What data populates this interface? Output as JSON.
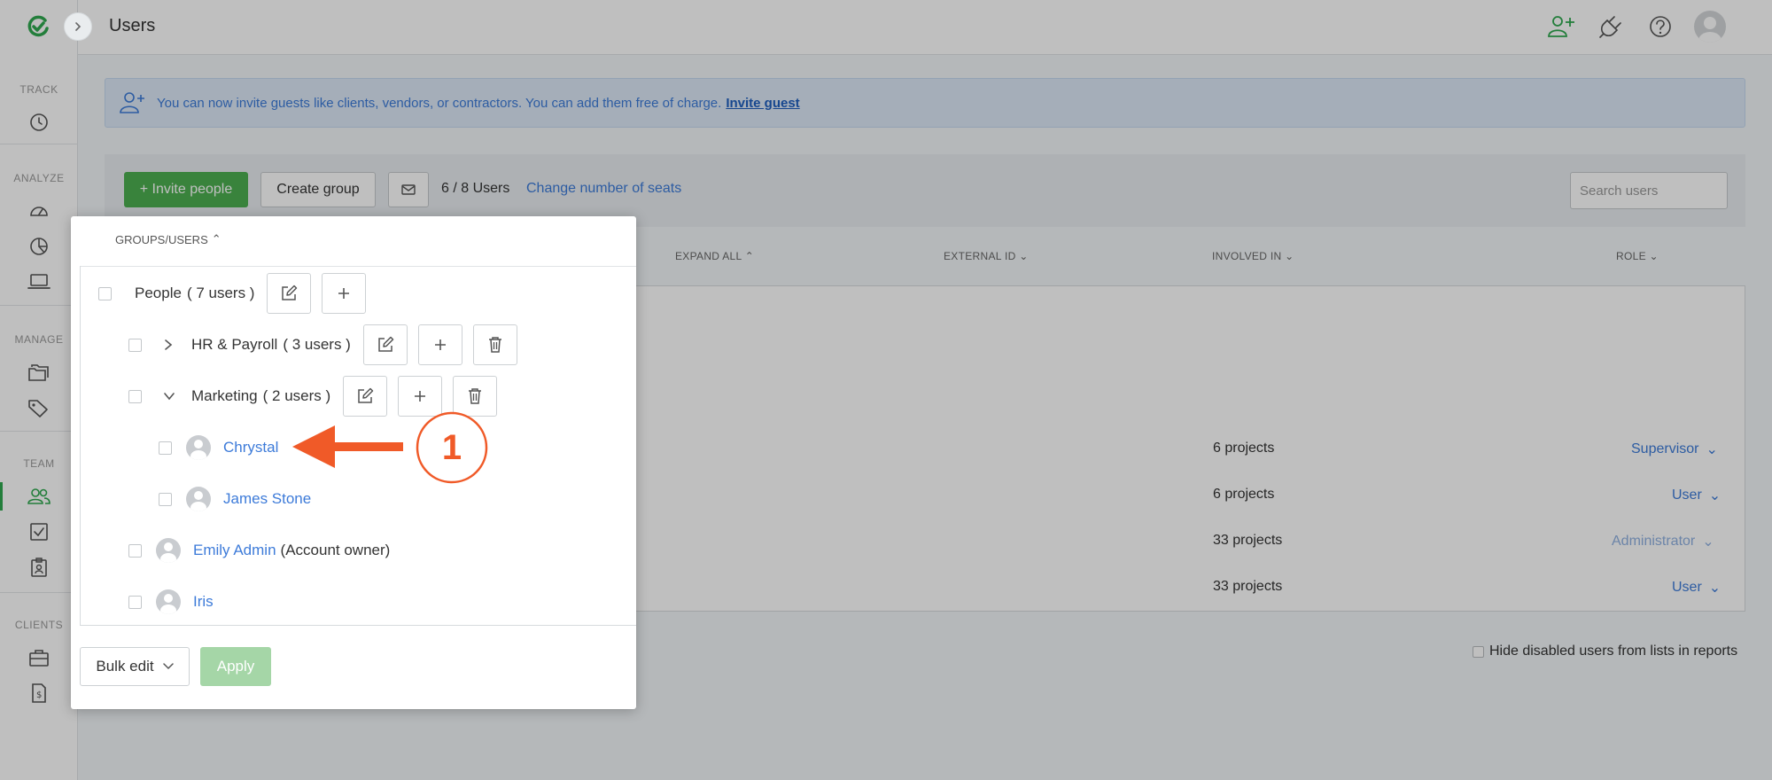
{
  "header": {
    "title": "Users"
  },
  "sidebar": {
    "sections": [
      {
        "label": "TRACK"
      },
      {
        "label": "ANALYZE"
      },
      {
        "label": "MANAGE"
      },
      {
        "label": "TEAM"
      },
      {
        "label": "CLIENTS"
      }
    ]
  },
  "banner": {
    "text": "You can now invite guests like clients, vendors, or contractors. You can add them free of charge.",
    "link": "Invite guest"
  },
  "toolbar": {
    "invite_label": "+ Invite people",
    "create_group_label": "Create group",
    "seats": "6 / 8 Users",
    "change_seats": "Change number of seats",
    "search_placeholder": "Search users"
  },
  "table": {
    "headers": {
      "expand_all": "EXPAND ALL",
      "external_id": "EXTERNAL ID",
      "involved_in": "INVOLVED IN",
      "role": "ROLE"
    },
    "rows": [
      {
        "involved": "6 projects",
        "role": "Supervisor"
      },
      {
        "involved": "6 projects",
        "role": "User"
      },
      {
        "involved": "33 projects",
        "role": "Administrator"
      },
      {
        "involved": "33 projects",
        "role": "User"
      }
    ],
    "hide_disabled": "Hide disabled users from lists in reports"
  },
  "popup": {
    "header": "GROUPS/USERS",
    "people_group": {
      "name": "People",
      "count": "( 7 users )"
    },
    "hr_group": {
      "name": "HR & Payroll",
      "count": "( 3 users )"
    },
    "marketing_group": {
      "name": "Marketing",
      "count": "( 2 users )"
    },
    "users": {
      "chrystal": "Chrystal",
      "james": "James Stone",
      "emily": "Emily Admin",
      "emily_note": "(Account owner)",
      "iris": "Iris"
    },
    "bulk_edit": "Bulk edit",
    "apply": "Apply"
  },
  "annotation": {
    "number": "1",
    "color": "#f05a28"
  },
  "colors": {
    "accent": "#4caf50",
    "link": "#3d7bd9"
  }
}
